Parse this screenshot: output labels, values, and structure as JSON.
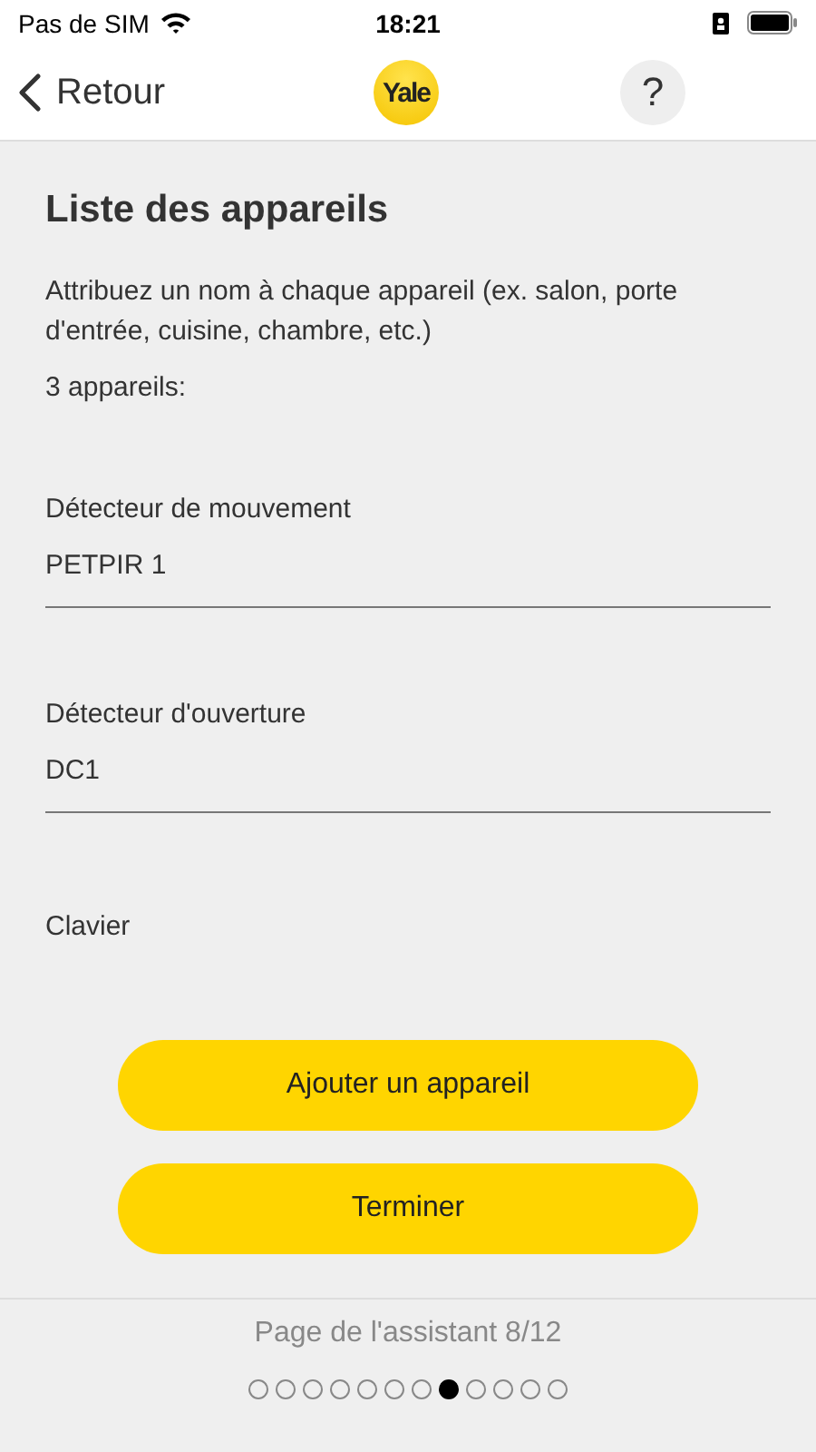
{
  "status_bar": {
    "carrier": "Pas de SIM",
    "time": "18:21"
  },
  "nav": {
    "back": "Retour",
    "logo": "Yale",
    "help": "?"
  },
  "title": "Liste des appareils",
  "description": "Attribuez un nom à chaque appareil (ex. salon, porte d'entrée, cuisine, chambre, etc.)",
  "count": "3 appareils:",
  "devices": [
    {
      "label": "Détecteur de mouvement",
      "value": "PETPIR 1"
    },
    {
      "label": "Détecteur d'ouverture",
      "value": "DC1"
    },
    {
      "label": "Clavier"
    }
  ],
  "buttons": [
    "Ajouter un appareil",
    "Terminer"
  ],
  "footer": {
    "page": "Page de l'assistant 8/12",
    "dots": [
      {
        "selected": false
      },
      {
        "selected": false
      },
      {
        "selected": false
      },
      {
        "selected": false
      },
      {
        "selected": false
      },
      {
        "selected": false
      },
      {
        "selected": false
      },
      {
        "selected": true
      },
      {
        "selected": false
      },
      {
        "selected": false
      },
      {
        "selected": false
      },
      {
        "selected": false
      }
    ]
  }
}
